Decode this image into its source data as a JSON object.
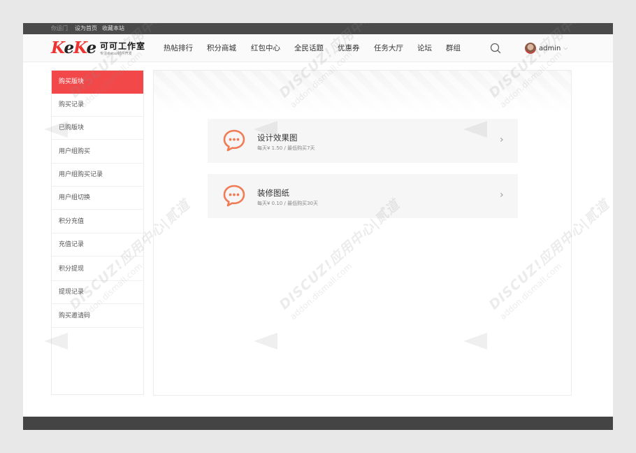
{
  "topbar": {
    "links": [
      "你运门",
      "设为首页",
      "收藏本站"
    ]
  },
  "header": {
    "logo": {
      "mark_red1": "K",
      "mark_dark1": "e",
      "mark_red2": "K",
      "mark_dark2": "e",
      "name": "可可工作室",
      "subtitle": "专注discuz插件开发"
    },
    "nav": [
      "热帖排行",
      "积分商城",
      "红包中心",
      "全民话题",
      "优惠券",
      "任务大厅",
      "论坛",
      "群组"
    ],
    "search_icon": "search-icon",
    "user": {
      "name": "admin",
      "chevron": "⌵"
    }
  },
  "sidebar": {
    "active_index": 0,
    "items": [
      "购买版块",
      "购买记录",
      "已购版块",
      "用户组购买",
      "用户组购买记录",
      "用户组切换",
      "积分充值",
      "充值记录",
      "积分提现",
      "提现记录",
      "购买邀请码"
    ]
  },
  "main": {
    "cards": [
      {
        "title": "设计效果图",
        "meta": "每天¥ 1.50 / 最低购买7天",
        "arrow": "›"
      },
      {
        "title": "装修图纸",
        "meta": "每天¥ 0.10 / 最低购买30天",
        "arrow": "›"
      }
    ]
  },
  "watermark": {
    "line1": "DISCUZ!应用中心|贰道",
    "line2": "addon.dismall.com"
  },
  "colors": {
    "accent": "#f2484a",
    "icon": "#f07b55",
    "topbar": "#4a4a4a",
    "footer": "#444444"
  }
}
